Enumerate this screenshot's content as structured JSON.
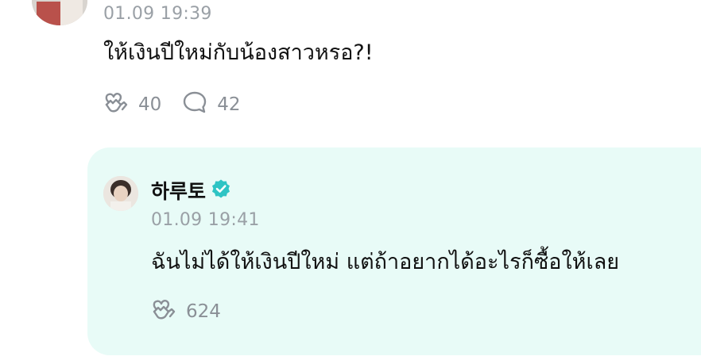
{
  "top_comment": {
    "timestamp": "01.09 19:39",
    "text": "ให้เงินปีใหม่กับน้องสาวหรอ?!",
    "likes": "40",
    "replies": "42"
  },
  "reply": {
    "author": "하루토",
    "verified": true,
    "timestamp": "01.09 19:41",
    "text": "ฉันไม่ได้ให้เงินปีใหม่ แต่ถ้าอยากได้อะไรก็ซื้อให้เลย",
    "likes": "624"
  },
  "colors": {
    "reply_background": "#e8fbf7",
    "verified_badge": "#2ec4c4",
    "meta_text": "#9aa0a6",
    "icon": "#8a8f96"
  },
  "icons": {
    "like": "heart-hands-icon",
    "comment": "speech-bubble-icon",
    "verified": "verified-badge-icon"
  }
}
